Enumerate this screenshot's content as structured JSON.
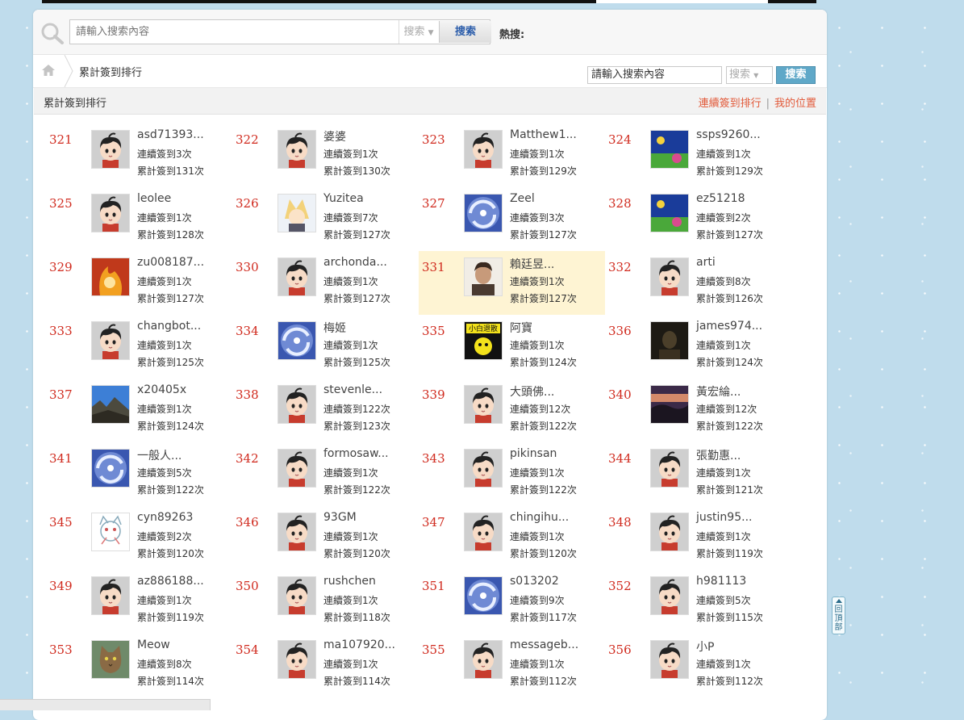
{
  "search": {
    "placeholder": "請輸入搜索內容",
    "type_label": "搜索",
    "button_label": "搜索",
    "hot_label": "熱搜:"
  },
  "breadcrumb": {
    "current": "累計簽到排行",
    "input_value": "請輸入搜索內容",
    "select_label": "搜索",
    "button_label": "搜索"
  },
  "section": {
    "title": "累計簽到排行",
    "link_consecutive": "連續簽到排行",
    "separator": "|",
    "link_my_position": "我的位置"
  },
  "highlight_rank": "331",
  "users": [
    {
      "rank": "321",
      "name": "asd71393...",
      "streak": "連續簽到3次",
      "total": "累計簽到131次",
      "avatar": "default-avatar"
    },
    {
      "rank": "322",
      "name": "婆婆",
      "streak": "連續簽到1次",
      "total": "累計簽到130次",
      "avatar": "default-avatar"
    },
    {
      "rank": "323",
      "name": "Matthew1...",
      "streak": "連續簽到1次",
      "total": "累計簽到129次",
      "avatar": "default-avatar"
    },
    {
      "rank": "324",
      "name": "ssps9260...",
      "streak": "連續簽到1次",
      "total": "累計簽到129次",
      "avatar": "photo-avatar"
    },
    {
      "rank": "325",
      "name": "leolee",
      "streak": "連續簽到1次",
      "total": "累計簽到128次",
      "avatar": "default-avatar"
    },
    {
      "rank": "326",
      "name": "Yuzitea",
      "streak": "連續簽到7次",
      "total": "累計簽到127次",
      "avatar": "anime-avatar"
    },
    {
      "rank": "327",
      "name": "Zeel",
      "streak": "連續簽到3次",
      "total": "累計簽到127次",
      "avatar": "typhoon-avatar"
    },
    {
      "rank": "328",
      "name": "ez51218",
      "streak": "連續簽到2次",
      "total": "累計簽到127次",
      "avatar": "photo-avatar"
    },
    {
      "rank": "329",
      "name": "zu008187...",
      "streak": "連續簽到1次",
      "total": "累計簽到127次",
      "avatar": "fire-avatar"
    },
    {
      "rank": "330",
      "name": "archonda...",
      "streak": "連續簽到1次",
      "total": "累計簽到127次",
      "avatar": "default-avatar"
    },
    {
      "rank": "331",
      "name": "賴廷昱...",
      "streak": "連續簽到1次",
      "total": "累計簽到127次",
      "avatar": "portrait-avatar"
    },
    {
      "rank": "332",
      "name": "arti",
      "streak": "連續簽到8次",
      "total": "累計簽到126次",
      "avatar": "default-avatar"
    },
    {
      "rank": "333",
      "name": "changbot...",
      "streak": "連續簽到1次",
      "total": "累計簽到125次",
      "avatar": "default-avatar"
    },
    {
      "rank": "334",
      "name": "梅姬",
      "streak": "連續簽到1次",
      "total": "累計簽到125次",
      "avatar": "typhoon-avatar"
    },
    {
      "rank": "335",
      "name": "阿寶",
      "streak": "連續簽到1次",
      "total": "累計簽到124次",
      "avatar": "sign-avatar"
    },
    {
      "rank": "336",
      "name": "james974...",
      "streak": "連續簽到1次",
      "total": "累計簽到124次",
      "avatar": "dark-avatar"
    },
    {
      "rank": "337",
      "name": "x20405x",
      "streak": "連續簽到1次",
      "total": "累計簽到124次",
      "avatar": "mountain-avatar"
    },
    {
      "rank": "338",
      "name": "stevenle...",
      "streak": "連續簽到122次",
      "total": "累計簽到123次",
      "avatar": "default-avatar"
    },
    {
      "rank": "339",
      "name": "大頭佛...",
      "streak": "連續簽到12次",
      "total": "累計簽到122次",
      "avatar": "default-avatar"
    },
    {
      "rank": "340",
      "name": "黃宏綸...",
      "streak": "連續簽到12次",
      "total": "累計簽到122次",
      "avatar": "sunset-avatar"
    },
    {
      "rank": "341",
      "name": "一般人...",
      "streak": "連續簽到5次",
      "total": "累計簽到122次",
      "avatar": "typhoon-avatar"
    },
    {
      "rank": "342",
      "name": "formosaw...",
      "streak": "連續簽到1次",
      "total": "累計簽到122次",
      "avatar": "default-avatar"
    },
    {
      "rank": "343",
      "name": "pikinsan",
      "streak": "連續簽到1次",
      "total": "累計簽到122次",
      "avatar": "default-avatar"
    },
    {
      "rank": "344",
      "name": "張勤惠...",
      "streak": "連續簽到1次",
      "total": "累計簽到121次",
      "avatar": "default-avatar"
    },
    {
      "rank": "345",
      "name": "cyn89263",
      "streak": "連續簽到2次",
      "total": "累計簽到120次",
      "avatar": "cat-drawing-avatar"
    },
    {
      "rank": "346",
      "name": "93GM",
      "streak": "連續簽到1次",
      "total": "累計簽到120次",
      "avatar": "default-avatar"
    },
    {
      "rank": "347",
      "name": "chingihu...",
      "streak": "連續簽到1次",
      "total": "累計簽到120次",
      "avatar": "default-avatar"
    },
    {
      "rank": "348",
      "name": "justin95...",
      "streak": "連續簽到1次",
      "total": "累計簽到119次",
      "avatar": "default-avatar"
    },
    {
      "rank": "349",
      "name": "az886188...",
      "streak": "連續簽到1次",
      "total": "累計簽到119次",
      "avatar": "default-avatar"
    },
    {
      "rank": "350",
      "name": "rushchen",
      "streak": "連續簽到1次",
      "total": "累計簽到118次",
      "avatar": "default-avatar"
    },
    {
      "rank": "351",
      "name": "s013202",
      "streak": "連續簽到9次",
      "total": "累計簽到117次",
      "avatar": "typhoon-avatar"
    },
    {
      "rank": "352",
      "name": "h981113",
      "streak": "連續簽到5次",
      "total": "累計簽到115次",
      "avatar": "default-avatar"
    },
    {
      "rank": "353",
      "name": "Meow",
      "streak": "連續簽到8次",
      "total": "累計簽到114次",
      "avatar": "cat-photo-avatar"
    },
    {
      "rank": "354",
      "name": "ma107920...",
      "streak": "連續簽到1次",
      "total": "累計簽到114次",
      "avatar": "default-avatar"
    },
    {
      "rank": "355",
      "name": "messageb...",
      "streak": "連續簽到1次",
      "total": "累計簽到112次",
      "avatar": "default-avatar"
    },
    {
      "rank": "356",
      "name": "小P",
      "streak": "連續簽到1次",
      "total": "累計簽到112次",
      "avatar": "default-avatar"
    }
  ],
  "back_to_top": "回頂部"
}
